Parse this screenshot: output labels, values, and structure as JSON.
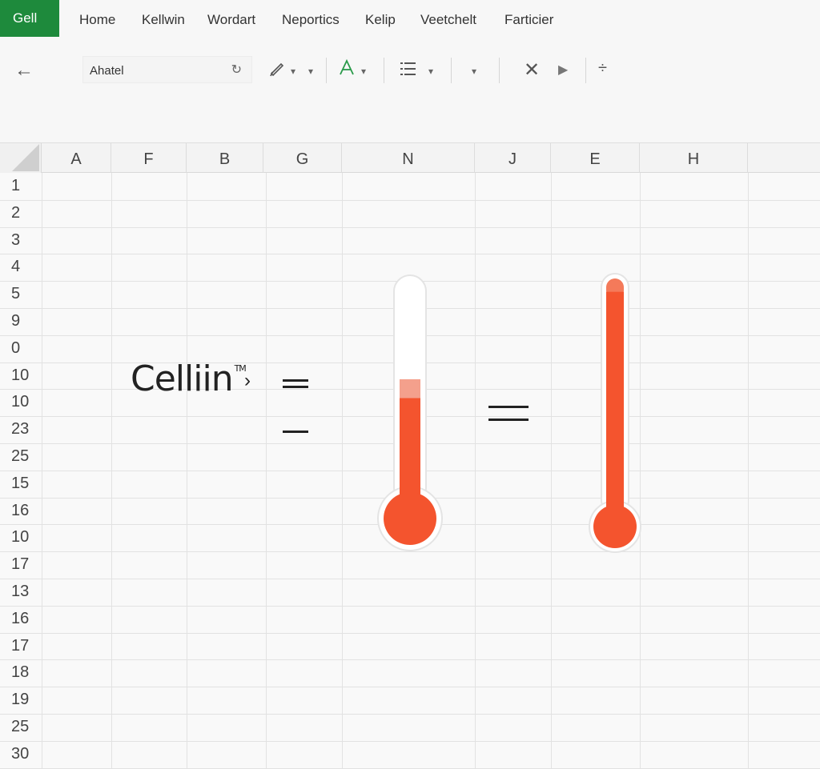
{
  "app": {
    "badge_label": "Gell"
  },
  "menu": {
    "items": [
      "Home",
      "Kellwin",
      "Wordart",
      "Neportics",
      "Kelip",
      "Veetchelt",
      "Farticier"
    ]
  },
  "toolbar": {
    "font_box_value": "Ahatel",
    "icons": [
      "back-arrow-icon",
      "refresh-icon",
      "pen-icon",
      "text-color-icon",
      "list-icon",
      "dropdown-icon",
      "close-icon",
      "play-icon",
      "divide-icon"
    ]
  },
  "grid": {
    "columns": [
      "A",
      "F",
      "B",
      "G",
      "N",
      "J",
      "E",
      "H"
    ],
    "rows": [
      "1",
      "2",
      "3",
      "4",
      "5",
      "9",
      "0",
      "10",
      "10",
      "23",
      "25",
      "15",
      "16",
      "10",
      "17",
      "13",
      "16",
      "17",
      "18",
      "19",
      "25",
      "30"
    ]
  },
  "content": {
    "cell_text": "Celliin",
    "trademark": "TM",
    "chevron": "›"
  },
  "thermometers": [
    {
      "name": "thermometer-left",
      "fill_fraction": 0.5,
      "highlight_fraction": 0.08
    },
    {
      "name": "thermometer-right",
      "fill_fraction": 0.97,
      "highlight_fraction": 0.0
    }
  ],
  "colors": {
    "brand": "#1e8a3c",
    "thermo_fill": "#f4542e",
    "thermo_highlight": "#f4a08c"
  }
}
